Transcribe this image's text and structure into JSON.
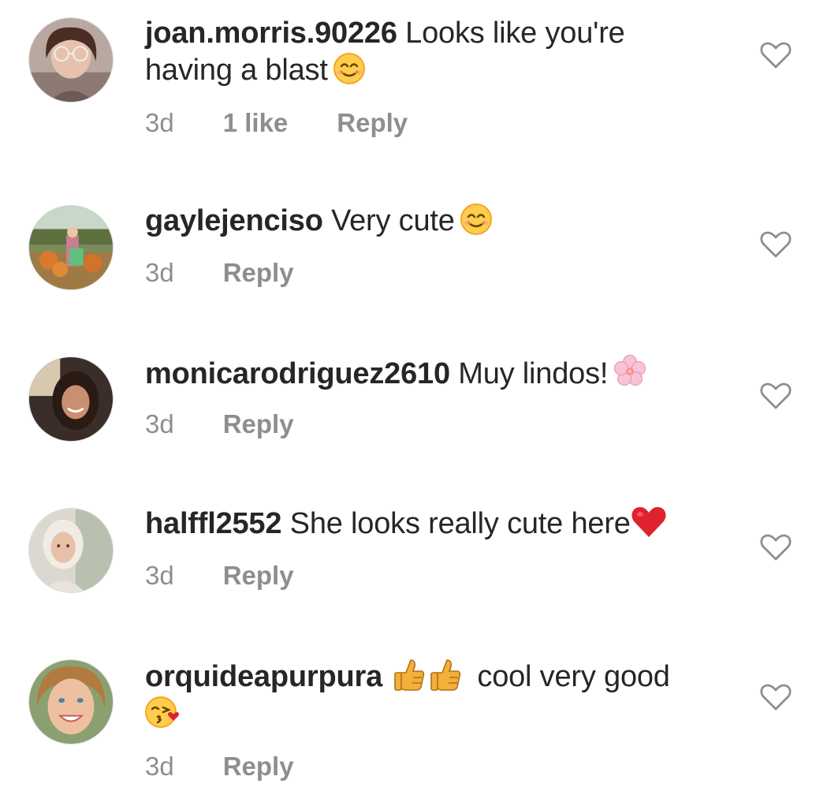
{
  "comments": [
    {
      "username": "joan.morris.90226",
      "text_line1": "Looks like you're",
      "text_line2": "having a blast",
      "emoji": "smiling-face-icon",
      "time": "3d",
      "likes": "1 like",
      "reply": "Reply"
    },
    {
      "username": "gaylejenciso",
      "text": "Very cute",
      "emoji": "smiling-face-icon",
      "time": "3d",
      "reply": "Reply"
    },
    {
      "username": "monicarodriguez2610",
      "text": "Muy lindos!",
      "emoji": "cherry-blossom-icon",
      "time": "3d",
      "reply": "Reply"
    },
    {
      "username": "halffl2552",
      "text": "She looks really cute here",
      "emoji": "red-heart-icon",
      "time": "3d",
      "reply": "Reply"
    },
    {
      "username": "orquideapurpura",
      "text": "cool very good",
      "emoji": "thumbs-up-icon",
      "emoji_line2": "face-blowing-kiss-icon",
      "time": "3d",
      "reply": "Reply"
    }
  ],
  "colors": {
    "text": "#262626",
    "meta": "#8e8e8e",
    "heart_outline": "#8e8e8e"
  }
}
